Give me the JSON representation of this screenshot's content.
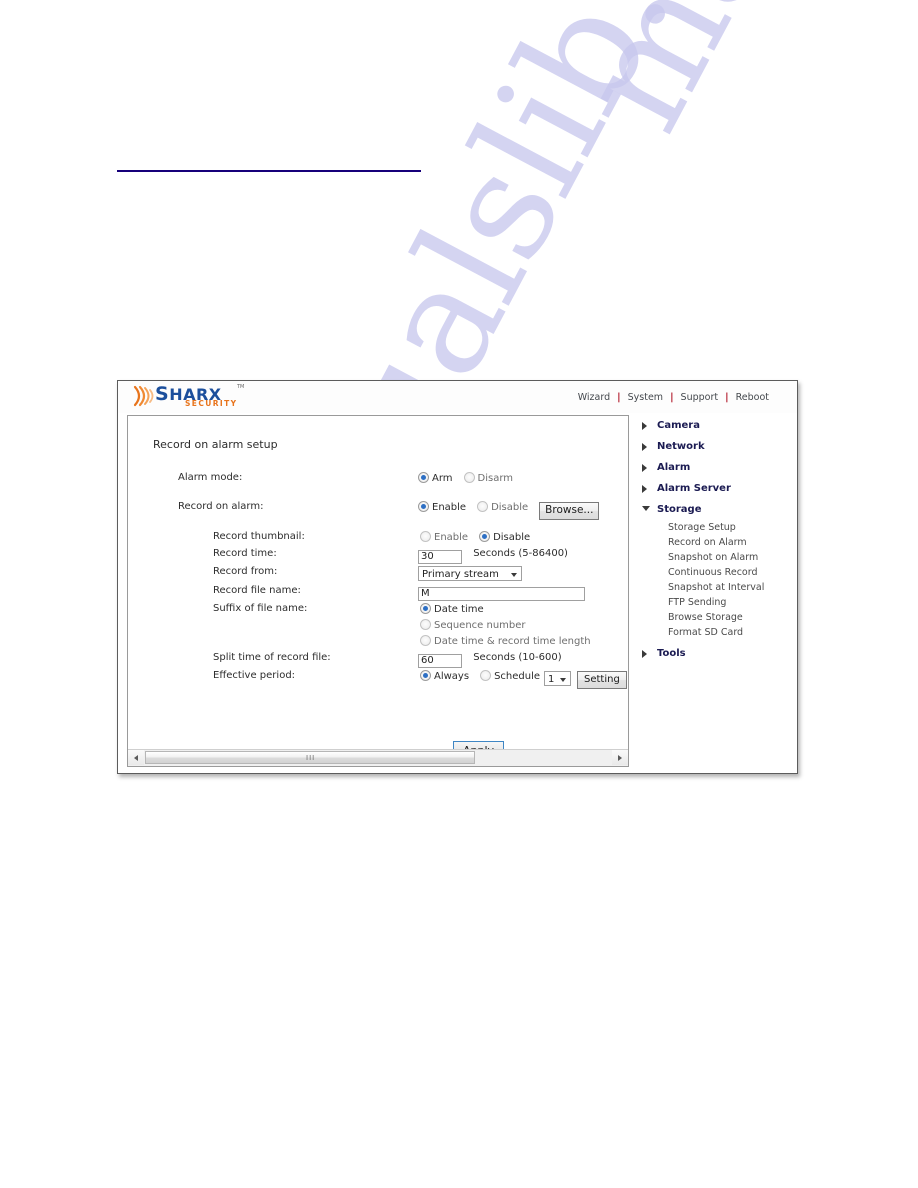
{
  "page": {
    "rule_present": true,
    "watermark_text": "manualslib.com"
  },
  "window": {
    "logo": {
      "brand_main": "HARX",
      "brand_initial": "S",
      "trademark": "TM",
      "brand_sub": "SECURITY",
      "arcs_color": "#e8741c",
      "word_color": "#1c4f9c"
    },
    "nav": {
      "separator": "|",
      "items": [
        {
          "label": "Wizard"
        },
        {
          "label": "System"
        },
        {
          "label": "Support"
        },
        {
          "label": "Reboot"
        }
      ]
    }
  },
  "content": {
    "title": "Record on alarm setup",
    "rows": {
      "alarm_mode": {
        "label": "Alarm mode:",
        "option_arm": "Arm",
        "option_disarm": "Disarm",
        "selected": "Arm"
      },
      "record_on_alarm": {
        "label": "Record on alarm:",
        "option_enable": "Enable",
        "option_disable": "Disable",
        "selected": "Enable",
        "browse_button": "Browse..."
      },
      "record_thumbnail": {
        "label": "Record thumbnail:",
        "option_enable": "Enable",
        "option_disable": "Disable",
        "selected": "Disable"
      },
      "record_time": {
        "label": "Record time:",
        "value": "30",
        "units": "Seconds (5-86400)"
      },
      "record_from": {
        "label": "Record from:",
        "value": "Primary stream"
      },
      "record_file_name": {
        "label": "Record file name:",
        "value": "M"
      },
      "suffix_of_file_name": {
        "label": "Suffix of file name:",
        "option_date_time": "Date time",
        "option_sequence_number": "Sequence number",
        "option_date_time_length": "Date time & record time length",
        "selected": "Date time"
      },
      "split_time": {
        "label": "Split time of record file:",
        "value": "60",
        "units": "Seconds (10-600)"
      },
      "effective_period": {
        "label": "Effective period:",
        "option_always": "Always",
        "option_schedule": "Schedule",
        "selected": "Always",
        "schedule_value": "1",
        "setting_button": "Setting"
      }
    },
    "apply_button": "Apply"
  },
  "sidebar": {
    "groups": [
      {
        "label": "Camera",
        "expanded": false,
        "items": []
      },
      {
        "label": "Network",
        "expanded": false,
        "items": []
      },
      {
        "label": "Alarm",
        "expanded": false,
        "items": []
      },
      {
        "label": "Alarm Server",
        "expanded": false,
        "items": []
      },
      {
        "label": "Storage",
        "expanded": true,
        "items": [
          {
            "label": "Storage Setup"
          },
          {
            "label": "Record on Alarm"
          },
          {
            "label": "Snapshot on Alarm"
          },
          {
            "label": "Continuous Record"
          },
          {
            "label": "Snapshot at Interval"
          },
          {
            "label": "FTP Sending"
          },
          {
            "label": "Browse Storage"
          },
          {
            "label": "Format SD Card"
          }
        ]
      },
      {
        "label": "Tools",
        "expanded": false,
        "items": []
      }
    ]
  },
  "scrollbar": {
    "left_arrow": "◄",
    "right_arrow": "►",
    "grip": "III"
  }
}
